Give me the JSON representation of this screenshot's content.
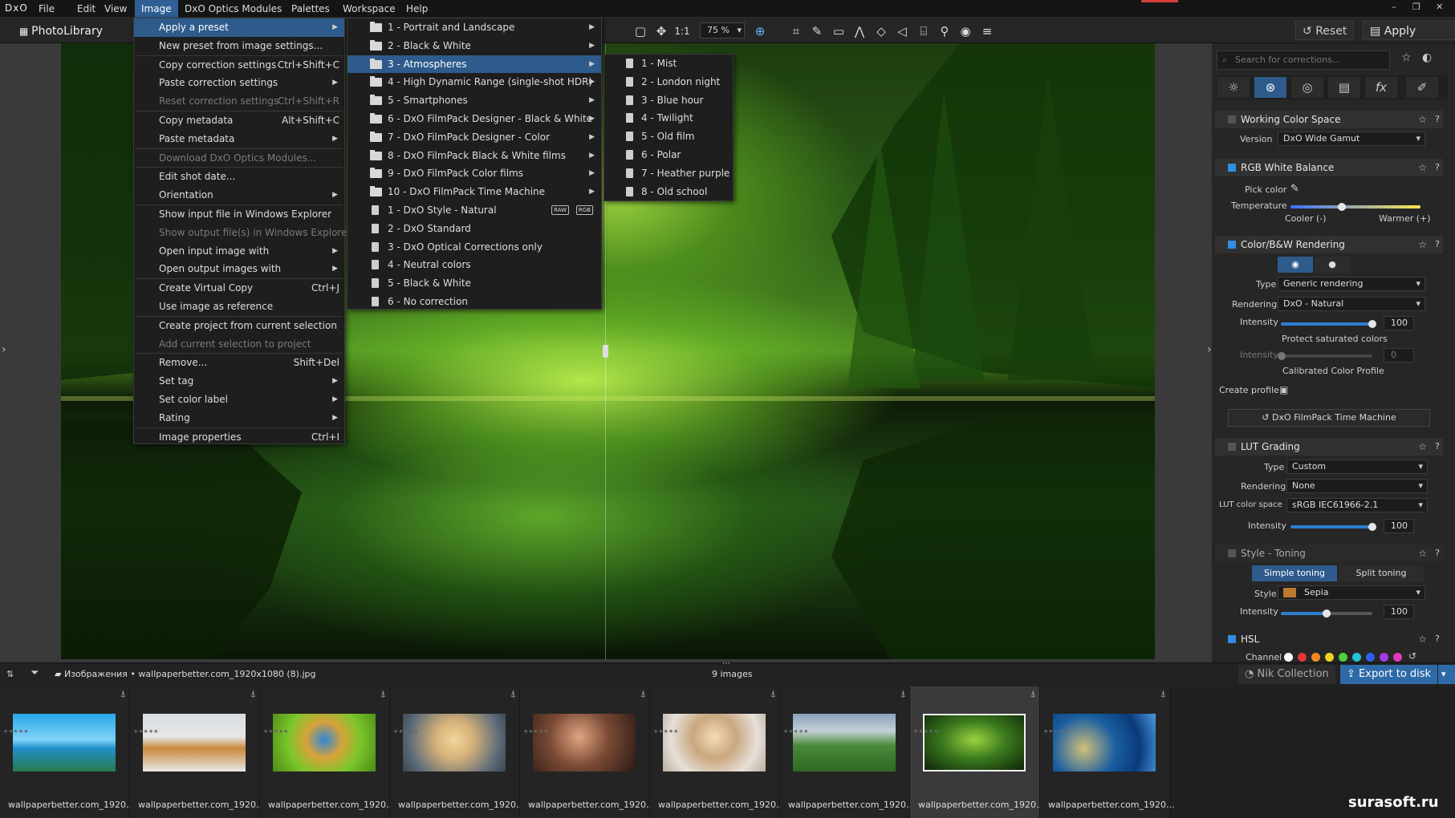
{
  "app": {
    "logo": "DxO"
  },
  "menubar": [
    "File",
    "Edit",
    "View",
    "Image",
    "DxO Optics Modules",
    "Palettes",
    "Workspace",
    "Help"
  ],
  "toolbar": {
    "photolibrary": "PhotoLibrary",
    "one_to_one": "1:1",
    "zoom": "75 %",
    "reset": "Reset",
    "apply_preset": "Apply preset"
  },
  "image_menu": [
    {
      "label": "Apply a preset",
      "arrow": true,
      "sel": true
    },
    {
      "label": "New preset from image settings..."
    },
    {
      "sep": true
    },
    {
      "label": "Copy correction settings",
      "sc": "Ctrl+Shift+C"
    },
    {
      "label": "Paste correction settings",
      "arrow": true
    },
    {
      "label": "Reset correction settings",
      "sc": "Ctrl+Shift+R",
      "dis": true
    },
    {
      "sep": true
    },
    {
      "label": "Copy metadata",
      "sc": "Alt+Shift+C"
    },
    {
      "label": "Paste metadata",
      "arrow": true
    },
    {
      "sep": true
    },
    {
      "label": "Download DxO Optics Modules...",
      "dis": true
    },
    {
      "sep": true
    },
    {
      "label": "Edit shot date..."
    },
    {
      "label": "Orientation",
      "arrow": true
    },
    {
      "sep": true
    },
    {
      "label": "Show input file in Windows Explorer"
    },
    {
      "label": "Show output file(s) in Windows Explorer",
      "dis": true
    },
    {
      "label": "Open input image with",
      "arrow": true
    },
    {
      "label": "Open output images with",
      "arrow": true
    },
    {
      "sep": true
    },
    {
      "label": "Create Virtual Copy",
      "sc": "Ctrl+J"
    },
    {
      "label": "Use image as reference"
    },
    {
      "sep": true
    },
    {
      "label": "Create project from current selection"
    },
    {
      "label": "Add current selection to project",
      "dis": true
    },
    {
      "sep": true
    },
    {
      "label": "Remove...",
      "sc": "Shift+Del"
    },
    {
      "label": "Set tag",
      "arrow": true
    },
    {
      "label": "Set color label",
      "arrow": true
    },
    {
      "label": "Rating",
      "arrow": true
    },
    {
      "sep": true
    },
    {
      "label": "Image properties",
      "sc": "Ctrl+I"
    }
  ],
  "preset_menu": [
    {
      "label": "1 - Portrait and Landscape",
      "folder": true,
      "arrow": true
    },
    {
      "label": "2 - Black & White",
      "folder": true,
      "arrow": true
    },
    {
      "label": "3 - Atmospheres",
      "folder": true,
      "arrow": true,
      "sel": true
    },
    {
      "label": "4 - High Dynamic Range (single-shot HDR)",
      "folder": true,
      "arrow": true
    },
    {
      "label": "5 - Smartphones",
      "folder": true,
      "arrow": true
    },
    {
      "label": "6 - DxO FilmPack Designer - Black & White",
      "folder": true,
      "arrow": true
    },
    {
      "label": "7 - DxO FilmPack Designer - Color",
      "folder": true,
      "arrow": true
    },
    {
      "label": "8 - DxO FilmPack Black & White films",
      "folder": true,
      "arrow": true
    },
    {
      "label": "9 - DxO FilmPack Color films",
      "folder": true,
      "arrow": true
    },
    {
      "label": "10 - DxO FilmPack Time Machine",
      "folder": true,
      "arrow": true
    },
    {
      "label": "1 - DxO Style - Natural",
      "badges": [
        "RAW",
        "RGB"
      ]
    },
    {
      "label": "2 - DxO Standard"
    },
    {
      "label": "3 - DxO Optical Corrections only"
    },
    {
      "label": "4 - Neutral colors"
    },
    {
      "label": "5 - Black & White"
    },
    {
      "label": "6 - No correction"
    }
  ],
  "atmo_menu": [
    "1 - Mist",
    "2 - London night",
    "3 - Blue hour",
    "4 - Twilight",
    "5 - Old film",
    "6 - Polar",
    "7 - Heather purple",
    "8 - Old school"
  ],
  "panel": {
    "search_placeholder": "Search for corrections...",
    "wcs": {
      "title": "Working Color Space",
      "version_label": "Version",
      "version": "DxO Wide Gamut"
    },
    "rgbwb": {
      "title": "RGB White Balance",
      "pick": "Pick color",
      "temp": "Temperature",
      "cooler": "Cooler (-)",
      "warmer": "Warmer (+)"
    },
    "cbw": {
      "title": "Color/B&W Rendering",
      "type_label": "Type",
      "type": "Generic rendering",
      "rend_label": "Rendering",
      "rend": "DxO - Natural",
      "int_label": "Intensity",
      "int": "100",
      "protect": "Protect saturated colors",
      "int2_label": "Intensity",
      "int2": "0",
      "calib": "Calibrated Color Profile",
      "create": "Create profile",
      "filmpack": "DxO FilmPack Time Machine"
    },
    "lut": {
      "title": "LUT Grading",
      "type_label": "Type",
      "type": "Custom",
      "rend_label": "Rendering",
      "rend": "None",
      "cs_label": "LUT color space",
      "cs": "sRGB IEC61966-2.1",
      "int_label": "Intensity",
      "int": "100"
    },
    "toning": {
      "title": "Style - Toning",
      "simple": "Simple toning",
      "split": "Split toning",
      "style_label": "Style",
      "style": "Sepia",
      "int_label": "Intensity",
      "int": "100"
    },
    "hsl": {
      "title": "HSL",
      "channel": "Channel"
    }
  },
  "bottom": {
    "folder": "Изображения",
    "file": "wallpaperbetter.com_1920x1080 (8).jpg",
    "count": "9 images",
    "nik": "Nik Collection",
    "export": "Export to disk"
  },
  "thumbs": [
    "wallpaperbetter.com_1920...",
    "wallpaperbetter.com_1920...",
    "wallpaperbetter.com_1920...",
    "wallpaperbetter.com_1920...",
    "wallpaperbetter.com_1920...",
    "wallpaperbetter.com_1920...",
    "wallpaperbetter.com_1920...",
    "wallpaperbetter.com_1920...",
    "wallpaperbetter.com_1920..."
  ],
  "watermark": "surasoft.ru"
}
